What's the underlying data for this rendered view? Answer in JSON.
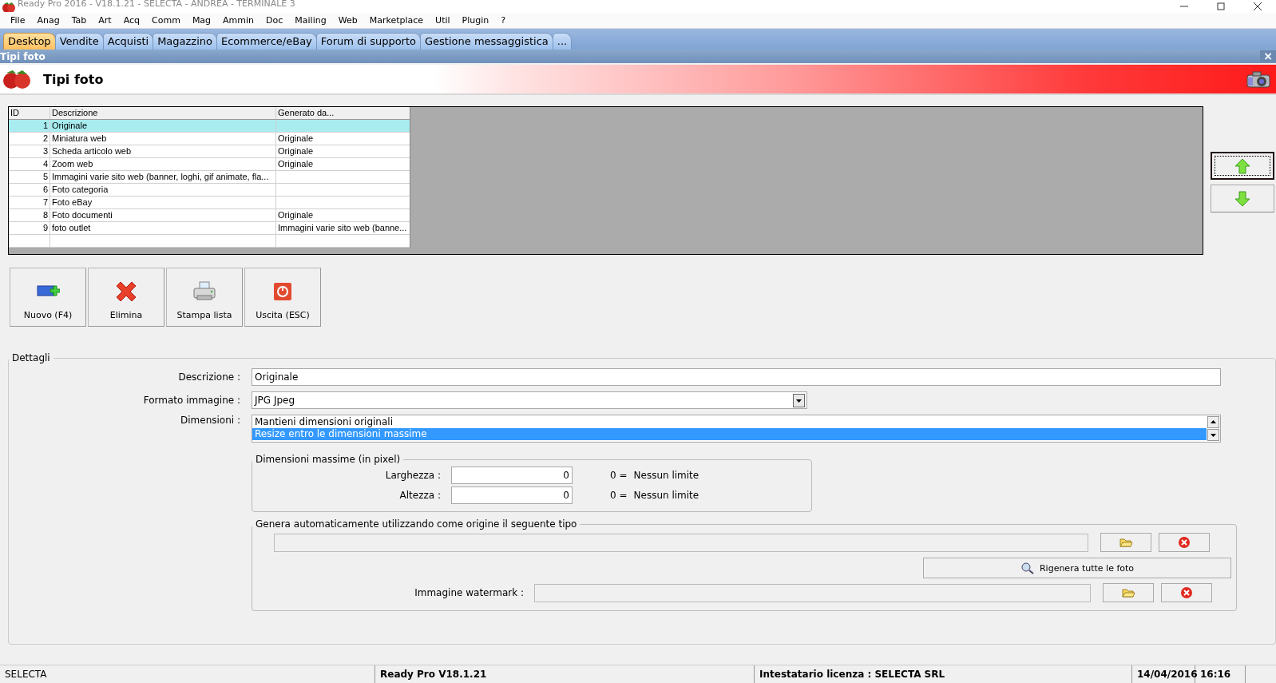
{
  "window": {
    "title": "Ready Pro 2016 - V18.1.21 - SELECTA - ANDREA - TERMINALE 3"
  },
  "menu": [
    "File",
    "Anag",
    "Tab",
    "Art",
    "Acq",
    "Comm",
    "Mag",
    "Ammin",
    "Doc",
    "Mailing",
    "Web",
    "Marketplace",
    "Util",
    "Plugin",
    "?"
  ],
  "tabs": [
    {
      "label": "Desktop",
      "selected": true
    },
    {
      "label": "Vendite",
      "selected": false
    },
    {
      "label": "Acquisti",
      "selected": false
    },
    {
      "label": "Magazzino",
      "selected": false
    },
    {
      "label": "Ecommerce/eBay",
      "selected": false
    },
    {
      "label": "Forum di supporto",
      "selected": false
    },
    {
      "label": "Gestione messaggistica",
      "selected": false
    },
    {
      "label": "...",
      "selected": false
    }
  ],
  "panel": {
    "title": "Tipi foto",
    "close": "×"
  },
  "header": {
    "title": "Tipi foto"
  },
  "table": {
    "columns": [
      "ID",
      "Descrizione",
      "Generato da..."
    ],
    "rows": [
      {
        "id": "1",
        "descrizione": "Originale",
        "generato_da": "",
        "selected": true
      },
      {
        "id": "2",
        "descrizione": "Miniatura web",
        "generato_da": "Originale",
        "selected": false
      },
      {
        "id": "3",
        "descrizione": "Scheda articolo web",
        "generato_da": "Originale",
        "selected": false
      },
      {
        "id": "4",
        "descrizione": "Zoom web",
        "generato_da": "Originale",
        "selected": false
      },
      {
        "id": "5",
        "descrizione": "Immagini varie sito web (banner, loghi, gif animate, fla...",
        "generato_da": "",
        "selected": false
      },
      {
        "id": "6",
        "descrizione": "Foto categoria",
        "generato_da": "",
        "selected": false
      },
      {
        "id": "7",
        "descrizione": "Foto eBay",
        "generato_da": "",
        "selected": false
      },
      {
        "id": "8",
        "descrizione": "Foto documenti",
        "generato_da": "Originale",
        "selected": false
      },
      {
        "id": "9",
        "descrizione": "foto outlet",
        "generato_da": "Immagini varie sito web (banne...",
        "selected": false
      }
    ]
  },
  "toolbar": [
    {
      "kind": "new",
      "label": "Nuovo (F4)"
    },
    {
      "kind": "delete",
      "label": "Elimina"
    },
    {
      "kind": "print",
      "label": "Stampa lista"
    },
    {
      "kind": "exit",
      "label": "Uscita (ESC)"
    }
  ],
  "details": {
    "title": "Dettagli",
    "descrizione": {
      "label": "Descrizione :",
      "value": "Originale"
    },
    "formato": {
      "label": "Formato immagine :",
      "value": "JPG Jpeg"
    },
    "dimensioni": {
      "label": "Dimensioni :",
      "options": [
        {
          "label": "Mantieni dimensioni originali",
          "selected": false
        },
        {
          "label": "Resize entro le dimensioni massime",
          "selected": true
        }
      ]
    },
    "max": {
      "title": "Dimensioni massime (in pixel)",
      "fields": [
        {
          "label": "Larghezza :",
          "value": "0",
          "hint_eq": "0 =",
          "hint": "Nessun limite"
        },
        {
          "label": "Altezza :",
          "value": "0",
          "hint_eq": "0 =",
          "hint": "Nessun limite"
        }
      ]
    },
    "genera": {
      "title": "Genera automaticamente utilizzando come origine il seguente tipo",
      "rigenera": "Rigenera tutte le foto",
      "watermark_label": "Immagine watermark :"
    }
  },
  "status_bar": [
    "SELECTA",
    "Ready Pro V18.1.21",
    "Intestatario licenza : SELECTA SRL",
    "14/04/2016",
    "16:16"
  ]
}
